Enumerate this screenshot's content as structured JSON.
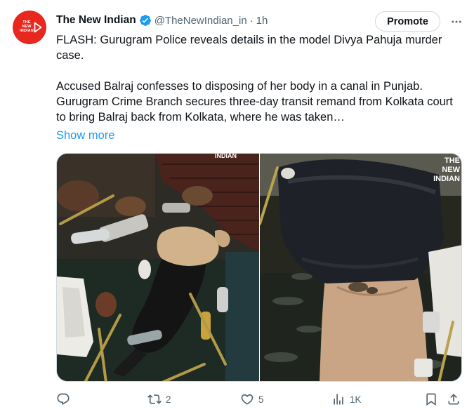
{
  "account": {
    "name": "The New Indian",
    "handle": "@TheNewIndian_in",
    "separator": "·",
    "time": "1h",
    "avatar_text": [
      "THE",
      "NEW",
      "INDIAN"
    ],
    "verified": true,
    "accent_color": "#e8271f"
  },
  "header_buttons": {
    "promote_label": "Promote",
    "more_icon": "more-horizontal-icon"
  },
  "post": {
    "paragraph1": "FLASH: Gurugram Police reveals details in the model Divya Pahuja murder case.",
    "paragraph2": "Accused Balraj confesses to disposing of her body in a canal in Punjab. Gurugram Crime Branch secures three-day transit remand from Kolkata court to bring Balraj back from Kolkata, where he was taken…",
    "show_more": "Show more"
  },
  "media": {
    "left_watermark": "INDIAN",
    "right_watermark": [
      "THE",
      "NEW",
      "INDIAN"
    ]
  },
  "actions": {
    "reply": {
      "icon": "reply-icon",
      "count": ""
    },
    "retweet": {
      "icon": "retweet-icon",
      "count": "2"
    },
    "like": {
      "icon": "heart-icon",
      "count": "5"
    },
    "views": {
      "icon": "views-icon",
      "count": "1K"
    },
    "bookmark": {
      "icon": "bookmark-icon"
    },
    "share": {
      "icon": "share-icon"
    }
  },
  "colors": {
    "text": "#0f1419",
    "secondary": "#536471",
    "link": "#1d9bf0",
    "verified": "#1d9bf0",
    "border": "#cfd9de"
  }
}
